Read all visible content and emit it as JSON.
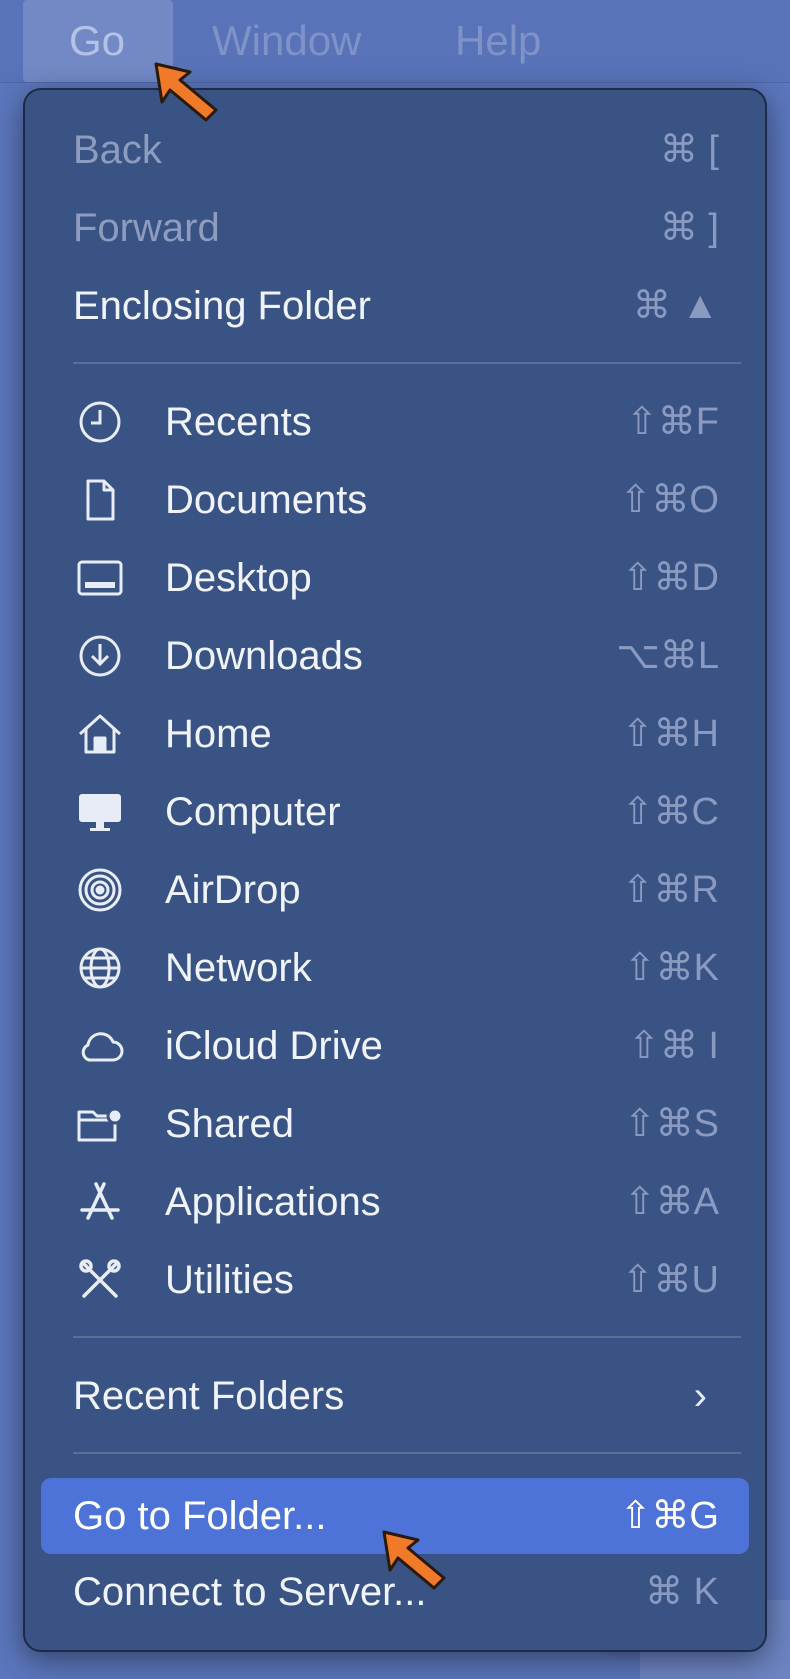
{
  "menubar": {
    "items": [
      {
        "label": "Go",
        "active": true
      },
      {
        "label": "Window",
        "active": false
      },
      {
        "label": "Help",
        "active": false
      }
    ]
  },
  "menu": {
    "top_items": [
      {
        "label": "Back",
        "shortcut": "⌘ [",
        "enabled": false
      },
      {
        "label": "Forward",
        "shortcut": "⌘ ]",
        "enabled": false
      },
      {
        "label": "Enclosing Folder",
        "shortcut": "⌘ ▲",
        "enabled": true
      }
    ],
    "places": [
      {
        "label": "Recents",
        "shortcut": "⇧⌘F",
        "icon": "clock-icon"
      },
      {
        "label": "Documents",
        "shortcut": "⇧⌘O",
        "icon": "document-icon"
      },
      {
        "label": "Desktop",
        "shortcut": "⇧⌘D",
        "icon": "desktop-icon"
      },
      {
        "label": "Downloads",
        "shortcut": "⌥⌘L",
        "icon": "download-icon"
      },
      {
        "label": "Home",
        "shortcut": "⇧⌘H",
        "icon": "home-icon"
      },
      {
        "label": "Computer",
        "shortcut": "⇧⌘C",
        "icon": "computer-icon"
      },
      {
        "label": "AirDrop",
        "shortcut": "⇧⌘R",
        "icon": "airdrop-icon"
      },
      {
        "label": "Network",
        "shortcut": "⇧⌘K",
        "icon": "globe-icon"
      },
      {
        "label": "iCloud Drive",
        "shortcut": "⇧⌘ I",
        "icon": "cloud-icon"
      },
      {
        "label": "Shared",
        "shortcut": "⇧⌘S",
        "icon": "shared-folder-icon"
      },
      {
        "label": "Applications",
        "shortcut": "⇧⌘A",
        "icon": "applications-icon"
      },
      {
        "label": "Utilities",
        "shortcut": "⇧⌘U",
        "icon": "utilities-icon"
      }
    ],
    "recent_folders": {
      "label": "Recent Folders",
      "submenu_indicator": "›"
    },
    "go_to_folder": {
      "label": "Go to Folder...",
      "shortcut": "⇧⌘G",
      "highlighted": true
    },
    "connect_to_server": {
      "label": "Connect to Server...",
      "shortcut": "⌘ K"
    }
  },
  "colors": {
    "menu_bg": "#3a5385",
    "highlight": "#4d73d8",
    "arrow": "#f07a2a"
  }
}
